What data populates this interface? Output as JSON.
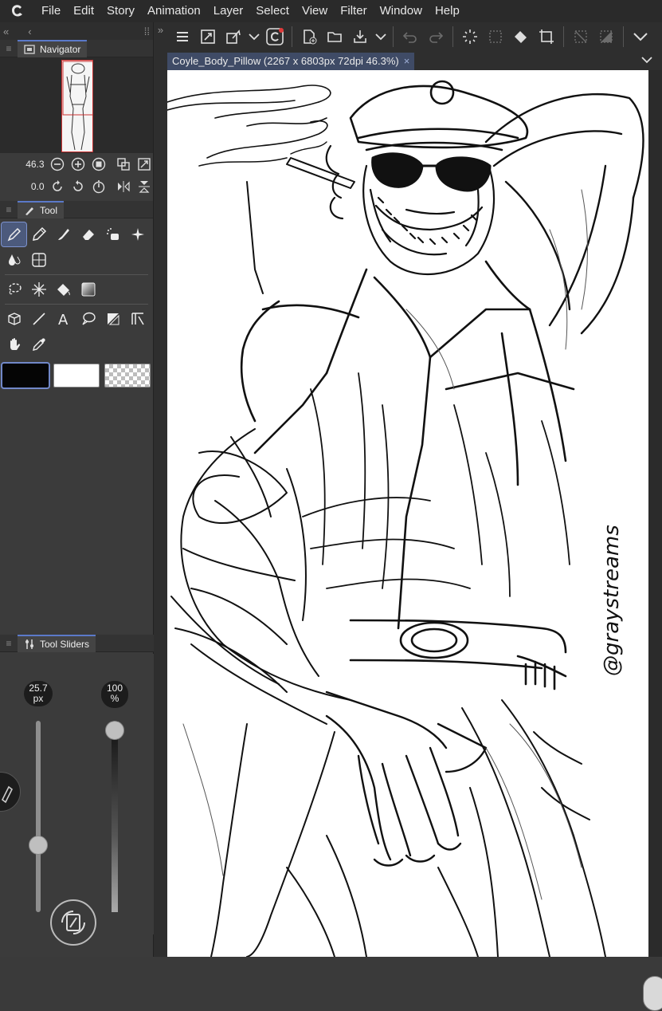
{
  "menu": [
    "File",
    "Edit",
    "Story",
    "Animation",
    "Layer",
    "Select",
    "View",
    "Filter",
    "Window",
    "Help"
  ],
  "navigator": {
    "title": "Navigator",
    "zoom": "46.3",
    "rotation": "0.0"
  },
  "tool_panel": {
    "title": "Tool"
  },
  "tool_sliders": {
    "title": "Tool Sliders",
    "brush_size": "25.7",
    "brush_size_unit": "px",
    "opacity": "100",
    "opacity_unit": "%",
    "brush_size_level": 0.35,
    "opacity_level": 1.0
  },
  "document": {
    "tab_title": "Coyle_Body_Pillow (2267 x 6803px 72dpi 46.3%)",
    "close_glyph": "×"
  },
  "artwork": {
    "signature": "@graystreams"
  },
  "colors": {
    "accent": "#5b79c9",
    "main_color": "#050505",
    "sub_color": "#ffffff"
  }
}
